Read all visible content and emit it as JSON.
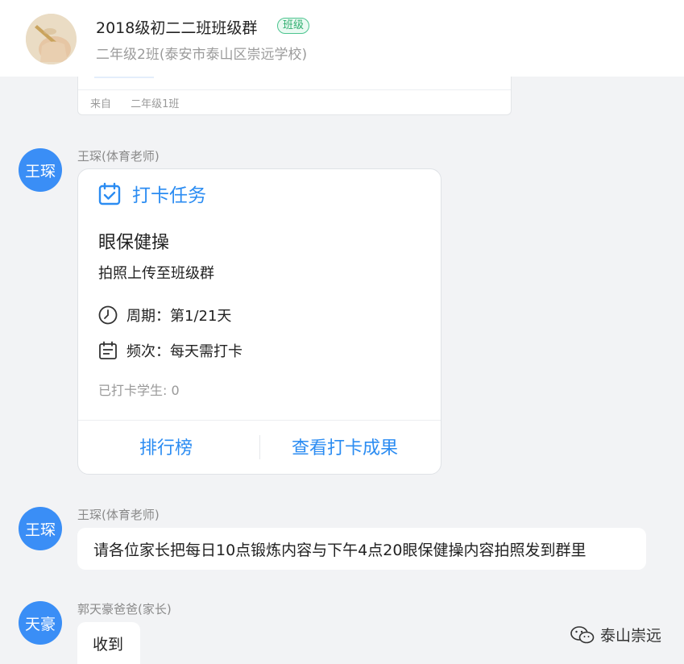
{
  "header": {
    "title": "2018级初二二班班级群",
    "badge": "班级",
    "subtitle": "二年级2班(泰安市泰山区崇远学校)"
  },
  "previous_card": {
    "from_label": "来自",
    "from_value": "二年级1班"
  },
  "messages": [
    {
      "avatar_text": "王琛",
      "sender": "王琛(体育老师)",
      "task": {
        "title": "打卡任务",
        "name": "眼保健操",
        "description": "拍照上传至班级群",
        "period_label": "周期：",
        "period_value": "第1/21天",
        "frequency_label": "频次：",
        "frequency_value": "每天需打卡",
        "checked_in": "已打卡学生: 0",
        "ranking_button": "排行榜",
        "results_button": "查看打卡成果"
      }
    },
    {
      "avatar_text": "王琛",
      "sender": "王琛(体育老师)",
      "text": "请各位家长把每日10点锻炼内容与下午4点20眼保健操内容拍照发到群里"
    },
    {
      "avatar_text": "天豪",
      "sender": "郭天豪爸爸(家长)",
      "text": "收到"
    }
  ],
  "watermark": {
    "text": "泰山崇远"
  },
  "colors": {
    "accent": "#2b8cf2",
    "avatar": "#3a8ef6",
    "badge_green": "#4cc48f",
    "background": "#f2f3f5"
  }
}
